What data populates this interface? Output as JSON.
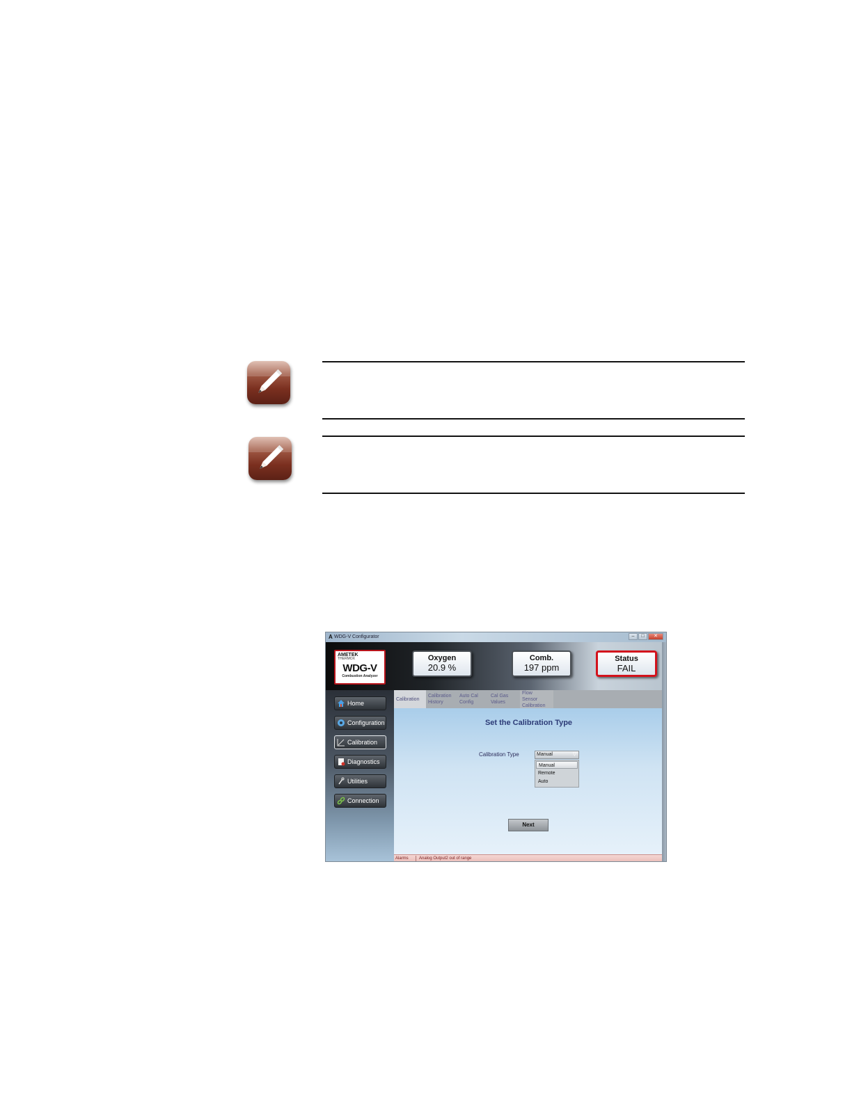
{
  "window": {
    "title": "WDG-V Configurator",
    "logo_glyph": "A",
    "buttons": [
      "–",
      "□",
      "✕"
    ]
  },
  "brand": {
    "line1": "AMETEK",
    "line2": "THERMOX",
    "product": "WDG-V",
    "subtitle": "Combustion Analyzer"
  },
  "gauges": {
    "oxygen": {
      "label": "Oxygen",
      "value": "20.9 %"
    },
    "comb": {
      "label": "Comb.",
      "value": "197 ppm"
    },
    "status": {
      "label": "Status",
      "value": "FAIL",
      "color": "#d3121c"
    }
  },
  "sidebar": {
    "items": [
      {
        "label": "Home",
        "icon": "home-icon"
      },
      {
        "label": "Configuration",
        "icon": "gear-icon"
      },
      {
        "label": "Calibration",
        "icon": "calibration-icon",
        "active": true
      },
      {
        "label": "Diagnostics",
        "icon": "diagnostics-icon"
      },
      {
        "label": "Utilities",
        "icon": "utilities-icon"
      },
      {
        "label": "Connection",
        "icon": "connection-icon"
      }
    ]
  },
  "tabs": [
    {
      "line1": "Calibration",
      "line2": "",
      "line3": ""
    },
    {
      "line1": "Calibration",
      "line2": "History",
      "line3": ""
    },
    {
      "line1": "Auto Cal",
      "line2": "Config",
      "line3": ""
    },
    {
      "line1": "Cal Gas",
      "line2": "Values",
      "line3": ""
    },
    {
      "line1": "Flow",
      "line2": "Sensor",
      "line3": "Calibration"
    }
  ],
  "content": {
    "heading": "Set the Calibration Type",
    "field_label": "Calibration Type",
    "selected": "Manual",
    "options": [
      "Manual",
      "Remote",
      "Auto"
    ],
    "next_label": "Next"
  },
  "alarms": {
    "label": "Alarms",
    "message": "Analog Output2 out of range"
  },
  "note_icons": [
    "pencil-note-icon",
    "pencil-note-icon"
  ]
}
